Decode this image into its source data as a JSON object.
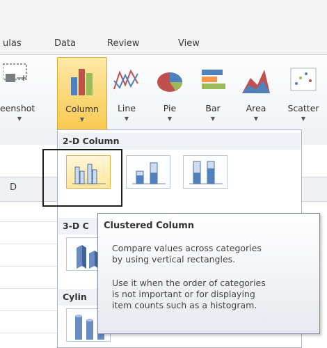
{
  "tabs": [
    "ulas",
    "Data",
    "Review",
    "View"
  ],
  "ribbon": {
    "screenshot_label": "eenshot",
    "buttons": [
      {
        "name": "column",
        "label": "Column"
      },
      {
        "name": "line",
        "label": "Line"
      },
      {
        "name": "pie",
        "label": "Pie"
      },
      {
        "name": "bar",
        "label": "Bar"
      },
      {
        "name": "area",
        "label": "Area"
      },
      {
        "name": "scatter",
        "label": "Scatter"
      }
    ],
    "dropdown_arrow": "▼"
  },
  "sheet": {
    "column_header": "D"
  },
  "gallery": {
    "section_2d": "2-D Column",
    "section_3d": "3-D C",
    "section_cyl": "Cylin"
  },
  "tooltip": {
    "title": "Clustered Column",
    "line1": "Compare values across categories",
    "line2": "by using vertical rectangles.",
    "line3": "Use it when the order of categories",
    "line4": "is not important or for displaying",
    "line5": "item counts such as a histogram."
  },
  "colors": {
    "accent_orange": "#f9c84f",
    "chart_blue": "#4f81bd",
    "chart_red": "#c0504d",
    "chart_green": "#9bbb59"
  }
}
